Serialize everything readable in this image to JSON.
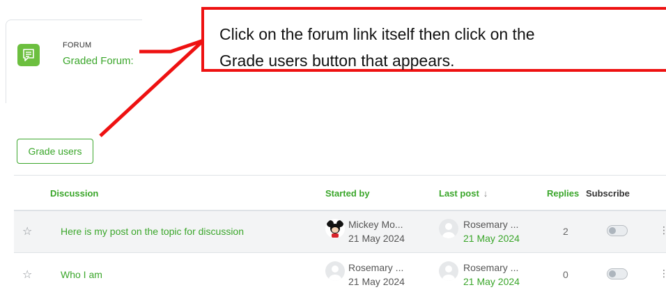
{
  "forum": {
    "kind_label": "FORUM",
    "link_label": "Graded Forum:",
    "icon": "forum-icon",
    "accent_color": "#6cbf3f"
  },
  "callout": {
    "line1": "Click on the forum link itself then click on the",
    "line2": "Grade users button that appears.",
    "border_color": "#ee1111"
  },
  "grade_button": {
    "label": "Grade users"
  },
  "table": {
    "headers": {
      "discussion": "Discussion",
      "started_by": "Started by",
      "last_post": "Last post",
      "last_post_sort_icon": "↓",
      "replies": "Replies",
      "subscribe": "Subscribe"
    },
    "rows": [
      {
        "title": "Here is my post on the topic for discussion",
        "started_by_name": "Mickey Mo...",
        "started_by_date": "21 May 2024",
        "started_by_avatar": "mickey-avatar",
        "last_post_name": "Rosemary ...",
        "last_post_date": "21 May 2024",
        "replies": "2",
        "subscribed": false
      },
      {
        "title": "Who I am",
        "started_by_name": "Rosemary ...",
        "started_by_date": "21 May 2024",
        "started_by_avatar": "default-avatar",
        "last_post_name": "Rosemary ...",
        "last_post_date": "21 May 2024",
        "replies": "0",
        "subscribed": false
      }
    ]
  }
}
